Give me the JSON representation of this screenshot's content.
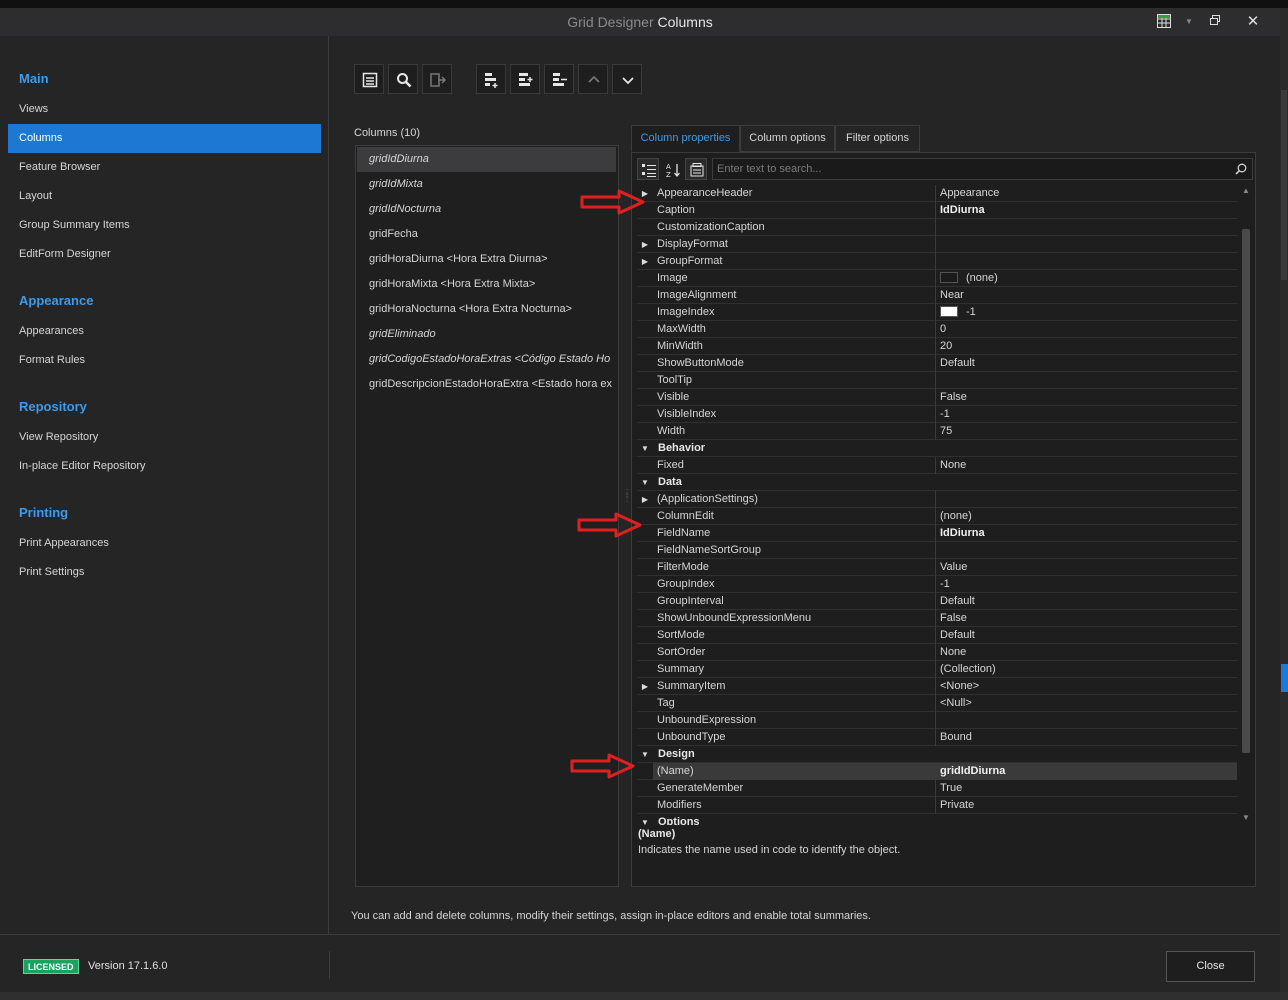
{
  "window": {
    "title_prefix": "Grid Designer",
    "title_main": "Columns"
  },
  "nav": {
    "groups": [
      {
        "label": "Main",
        "items": [
          "Views",
          "Columns",
          "Feature Browser",
          "Layout",
          "Group Summary Items",
          "EditForm Designer"
        ]
      },
      {
        "label": "Appearance",
        "items": [
          "Appearances",
          "Format Rules"
        ]
      },
      {
        "label": "Repository",
        "items": [
          "View Repository",
          "In-place Editor Repository"
        ]
      },
      {
        "label": "Printing",
        "items": [
          "Print Appearances",
          "Print Settings"
        ]
      }
    ],
    "selected": "Columns"
  },
  "toolbar": {
    "icons": [
      "grid-view-icon",
      "search-icon",
      "retrieve-fields-icon",
      "add-column-icon",
      "insert-column-icon",
      "remove-column-icon",
      "move-up-icon",
      "move-down-icon"
    ]
  },
  "columns": {
    "label": "Columns (10)",
    "items": [
      {
        "text": "gridIdDiurna",
        "italic": true
      },
      {
        "text": "gridIdMixta",
        "italic": true
      },
      {
        "text": "gridIdNocturna",
        "italic": true
      },
      {
        "text": "gridFecha",
        "italic": false
      },
      {
        "text": "gridHoraDiurna <Hora Extra Diurna>",
        "italic": false
      },
      {
        "text": "gridHoraMixta <Hora Extra Mixta>",
        "italic": false
      },
      {
        "text": "gridHoraNocturna <Hora Extra Nocturna>",
        "italic": false
      },
      {
        "text": "gridEliminado",
        "italic": true
      },
      {
        "text": "gridCodigoEstadoHoraExtras <Código Estado Ho",
        "italic": true
      },
      {
        "text": "gridDescripcionEstadoHoraExtra <Estado hora ex",
        "italic": false
      }
    ],
    "selected_index": 0
  },
  "tabs": [
    "Column properties",
    "Column options",
    "Filter options"
  ],
  "active_tab": 0,
  "search": {
    "placeholder": "Enter text to search..."
  },
  "properties": [
    {
      "name": "AppearanceHeader",
      "value": "Appearance",
      "expand": "right"
    },
    {
      "name": "Caption",
      "value": "IdDiurna",
      "bold": true
    },
    {
      "name": "CustomizationCaption",
      "value": ""
    },
    {
      "name": "DisplayFormat",
      "value": "",
      "expand": "right"
    },
    {
      "name": "GroupFormat",
      "value": "",
      "expand": "right"
    },
    {
      "name": "Image",
      "value": "(none)",
      "swatch": "#1a1a1a"
    },
    {
      "name": "ImageAlignment",
      "value": "Near"
    },
    {
      "name": "ImageIndex",
      "value": "-1",
      "swatch": "#ffffff"
    },
    {
      "name": "MaxWidth",
      "value": "0"
    },
    {
      "name": "MinWidth",
      "value": "20"
    },
    {
      "name": "ShowButtonMode",
      "value": "Default"
    },
    {
      "name": "ToolTip",
      "value": ""
    },
    {
      "name": "Visible",
      "value": "False"
    },
    {
      "name": "VisibleIndex",
      "value": "-1"
    },
    {
      "name": "Width",
      "value": "75"
    },
    {
      "name": "Behavior",
      "category": true
    },
    {
      "name": "Fixed",
      "value": "None"
    },
    {
      "name": "Data",
      "category": true
    },
    {
      "name": "(ApplicationSettings)",
      "value": "",
      "expand": "right"
    },
    {
      "name": "ColumnEdit",
      "value": "(none)"
    },
    {
      "name": "FieldName",
      "value": "IdDiurna",
      "bold": true
    },
    {
      "name": "FieldNameSortGroup",
      "value": ""
    },
    {
      "name": "FilterMode",
      "value": "Value"
    },
    {
      "name": "GroupIndex",
      "value": "-1"
    },
    {
      "name": "GroupInterval",
      "value": "Default"
    },
    {
      "name": "ShowUnboundExpressionMenu",
      "value": "False"
    },
    {
      "name": "SortMode",
      "value": "Default"
    },
    {
      "name": "SortOrder",
      "value": "None"
    },
    {
      "name": "Summary",
      "value": "(Collection)"
    },
    {
      "name": "SummaryItem",
      "value": "<None>",
      "expand": "right"
    },
    {
      "name": "Tag",
      "value": "<Null>"
    },
    {
      "name": "UnboundExpression",
      "value": ""
    },
    {
      "name": "UnboundType",
      "value": "Bound"
    },
    {
      "name": "Design",
      "category": true
    },
    {
      "name": "(Name)",
      "value": "gridIdDiurna",
      "bold": true,
      "selected": true
    },
    {
      "name": "GenerateMember",
      "value": "True"
    },
    {
      "name": "Modifiers",
      "value": "Private"
    },
    {
      "name": "Options",
      "category": true
    }
  ],
  "description": {
    "title": "(Name)",
    "text": "Indicates the name used in code to identify the object."
  },
  "hint": "You can add and delete columns, modify their settings, assign in-place editors and enable total summaries.",
  "footer": {
    "badge": "LICENSED",
    "version": "Version 17.1.6.0",
    "close_label": "Close"
  },
  "annotations": {
    "arrow_color": "#e02020",
    "arrow_targets": [
      "Caption",
      "FieldName",
      "(Name)"
    ]
  },
  "colors": {
    "accent": "#1c78d2",
    "link_blue": "#3c9bea",
    "license_green": "#1aa260"
  }
}
